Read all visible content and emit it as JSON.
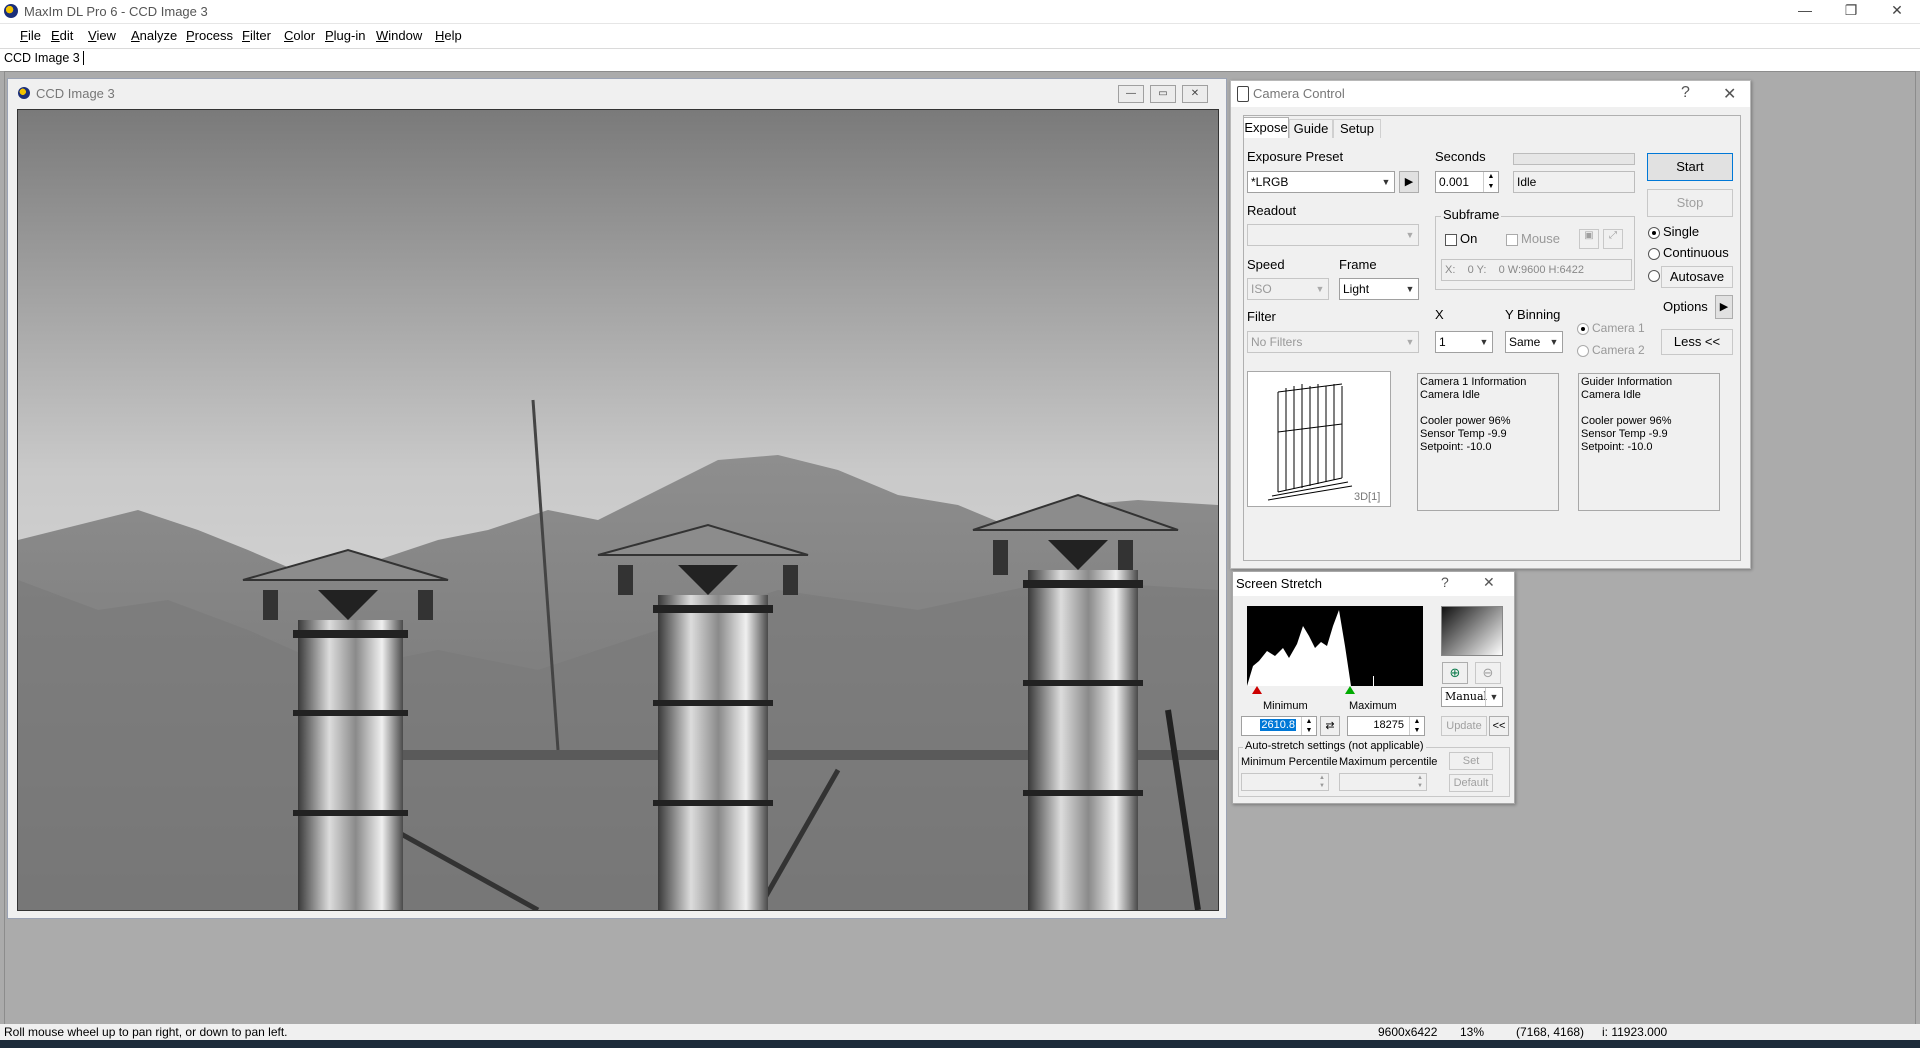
{
  "app": {
    "title": "MaxIm DL Pro 6 - CCD Image 3",
    "window_controls": {
      "minimize": "—",
      "restore": "❐",
      "close": "✕"
    }
  },
  "menu": {
    "items": [
      {
        "label": "File",
        "key": "F",
        "rest": "ile"
      },
      {
        "label": "Edit",
        "key": "E",
        "rest": "dit"
      },
      {
        "label": "View",
        "key": "V",
        "rest": "iew"
      },
      {
        "label": "Analyze",
        "key": "A",
        "rest": "nalyze"
      },
      {
        "label": "Process",
        "key": "P",
        "rest": "rocess"
      },
      {
        "label": "Filter",
        "key": "F",
        "rest": "ilter"
      },
      {
        "label": "Color",
        "key": "C",
        "rest": "olor"
      },
      {
        "label": "Plug-in",
        "key": "P",
        "rest": "lug-in"
      },
      {
        "label": "Window",
        "key": "W",
        "rest": "indow"
      },
      {
        "label": "Help",
        "key": "H",
        "rest": "elp"
      }
    ]
  },
  "doc_tab": {
    "label": "CCD Image 3"
  },
  "image_window": {
    "title": "CCD Image 3",
    "controls": {
      "minimize": "—",
      "maximize": "▭",
      "close": "✕"
    }
  },
  "camera_control": {
    "title": "Camera Control",
    "help": "?",
    "close": "✕",
    "tabs": [
      "Expose",
      "Guide",
      "Setup"
    ],
    "exposure_preset": {
      "label": "Exposure Preset",
      "value": "*LRGB"
    },
    "seconds": {
      "label": "Seconds",
      "value": "0.001"
    },
    "status": "Idle",
    "readout": {
      "label": "Readout",
      "value": ""
    },
    "speed": {
      "label": "Speed",
      "value": "ISO"
    },
    "frame": {
      "label": "Frame",
      "value": "Light"
    },
    "filter": {
      "label": "Filter",
      "value": "No Filters"
    },
    "subframe": {
      "label": "Subframe",
      "on_label": "On",
      "mouse_label": "Mouse",
      "coords": "X:    0 Y:    0 W:9600 H:6422"
    },
    "x_binning": {
      "label": "X",
      "value": "1"
    },
    "y_binning": {
      "label": "Y Binning",
      "value": "Same"
    },
    "camera1": "Camera 1",
    "camera2": "Camera 2",
    "buttons": {
      "start": "Start",
      "stop": "Stop",
      "less": "Less <<",
      "options": "Options"
    },
    "mode": {
      "single": "Single",
      "continuous": "Continuous",
      "autosave": "Autosave",
      "selected": "single"
    },
    "preview_label": "3D[1]",
    "camera1_info": "Camera 1 Information\nCamera Idle\n\nCooler power 96%\nSensor Temp -9.9\nSetpoint: -10.0",
    "guider_info": "Guider Information\nCamera Idle\n\nCooler power 96%\nSensor Temp -9.9\nSetpoint: -10.0"
  },
  "screen_stretch": {
    "title": "Screen Stretch",
    "help": "?",
    "close": "✕",
    "min_label": "Minimum",
    "max_label": "Maximum",
    "min_value": "2610.8",
    "max_value": "18275",
    "mode": "Manual",
    "update": "Update",
    "collapse": "<<",
    "auto_title": "Auto-stretch settings (not applicable)",
    "min_percentile": "Minimum Percentile",
    "max_percentile": "Maximum percentile",
    "set": "Set",
    "default": "Default"
  },
  "statusbar": {
    "hint": "Roll mouse wheel up to pan right, or down to pan left.",
    "dimensions": "9600x6422",
    "zoom": "13%",
    "coords": "(7168, 4168)",
    "intensity": "i: 11923.000"
  }
}
